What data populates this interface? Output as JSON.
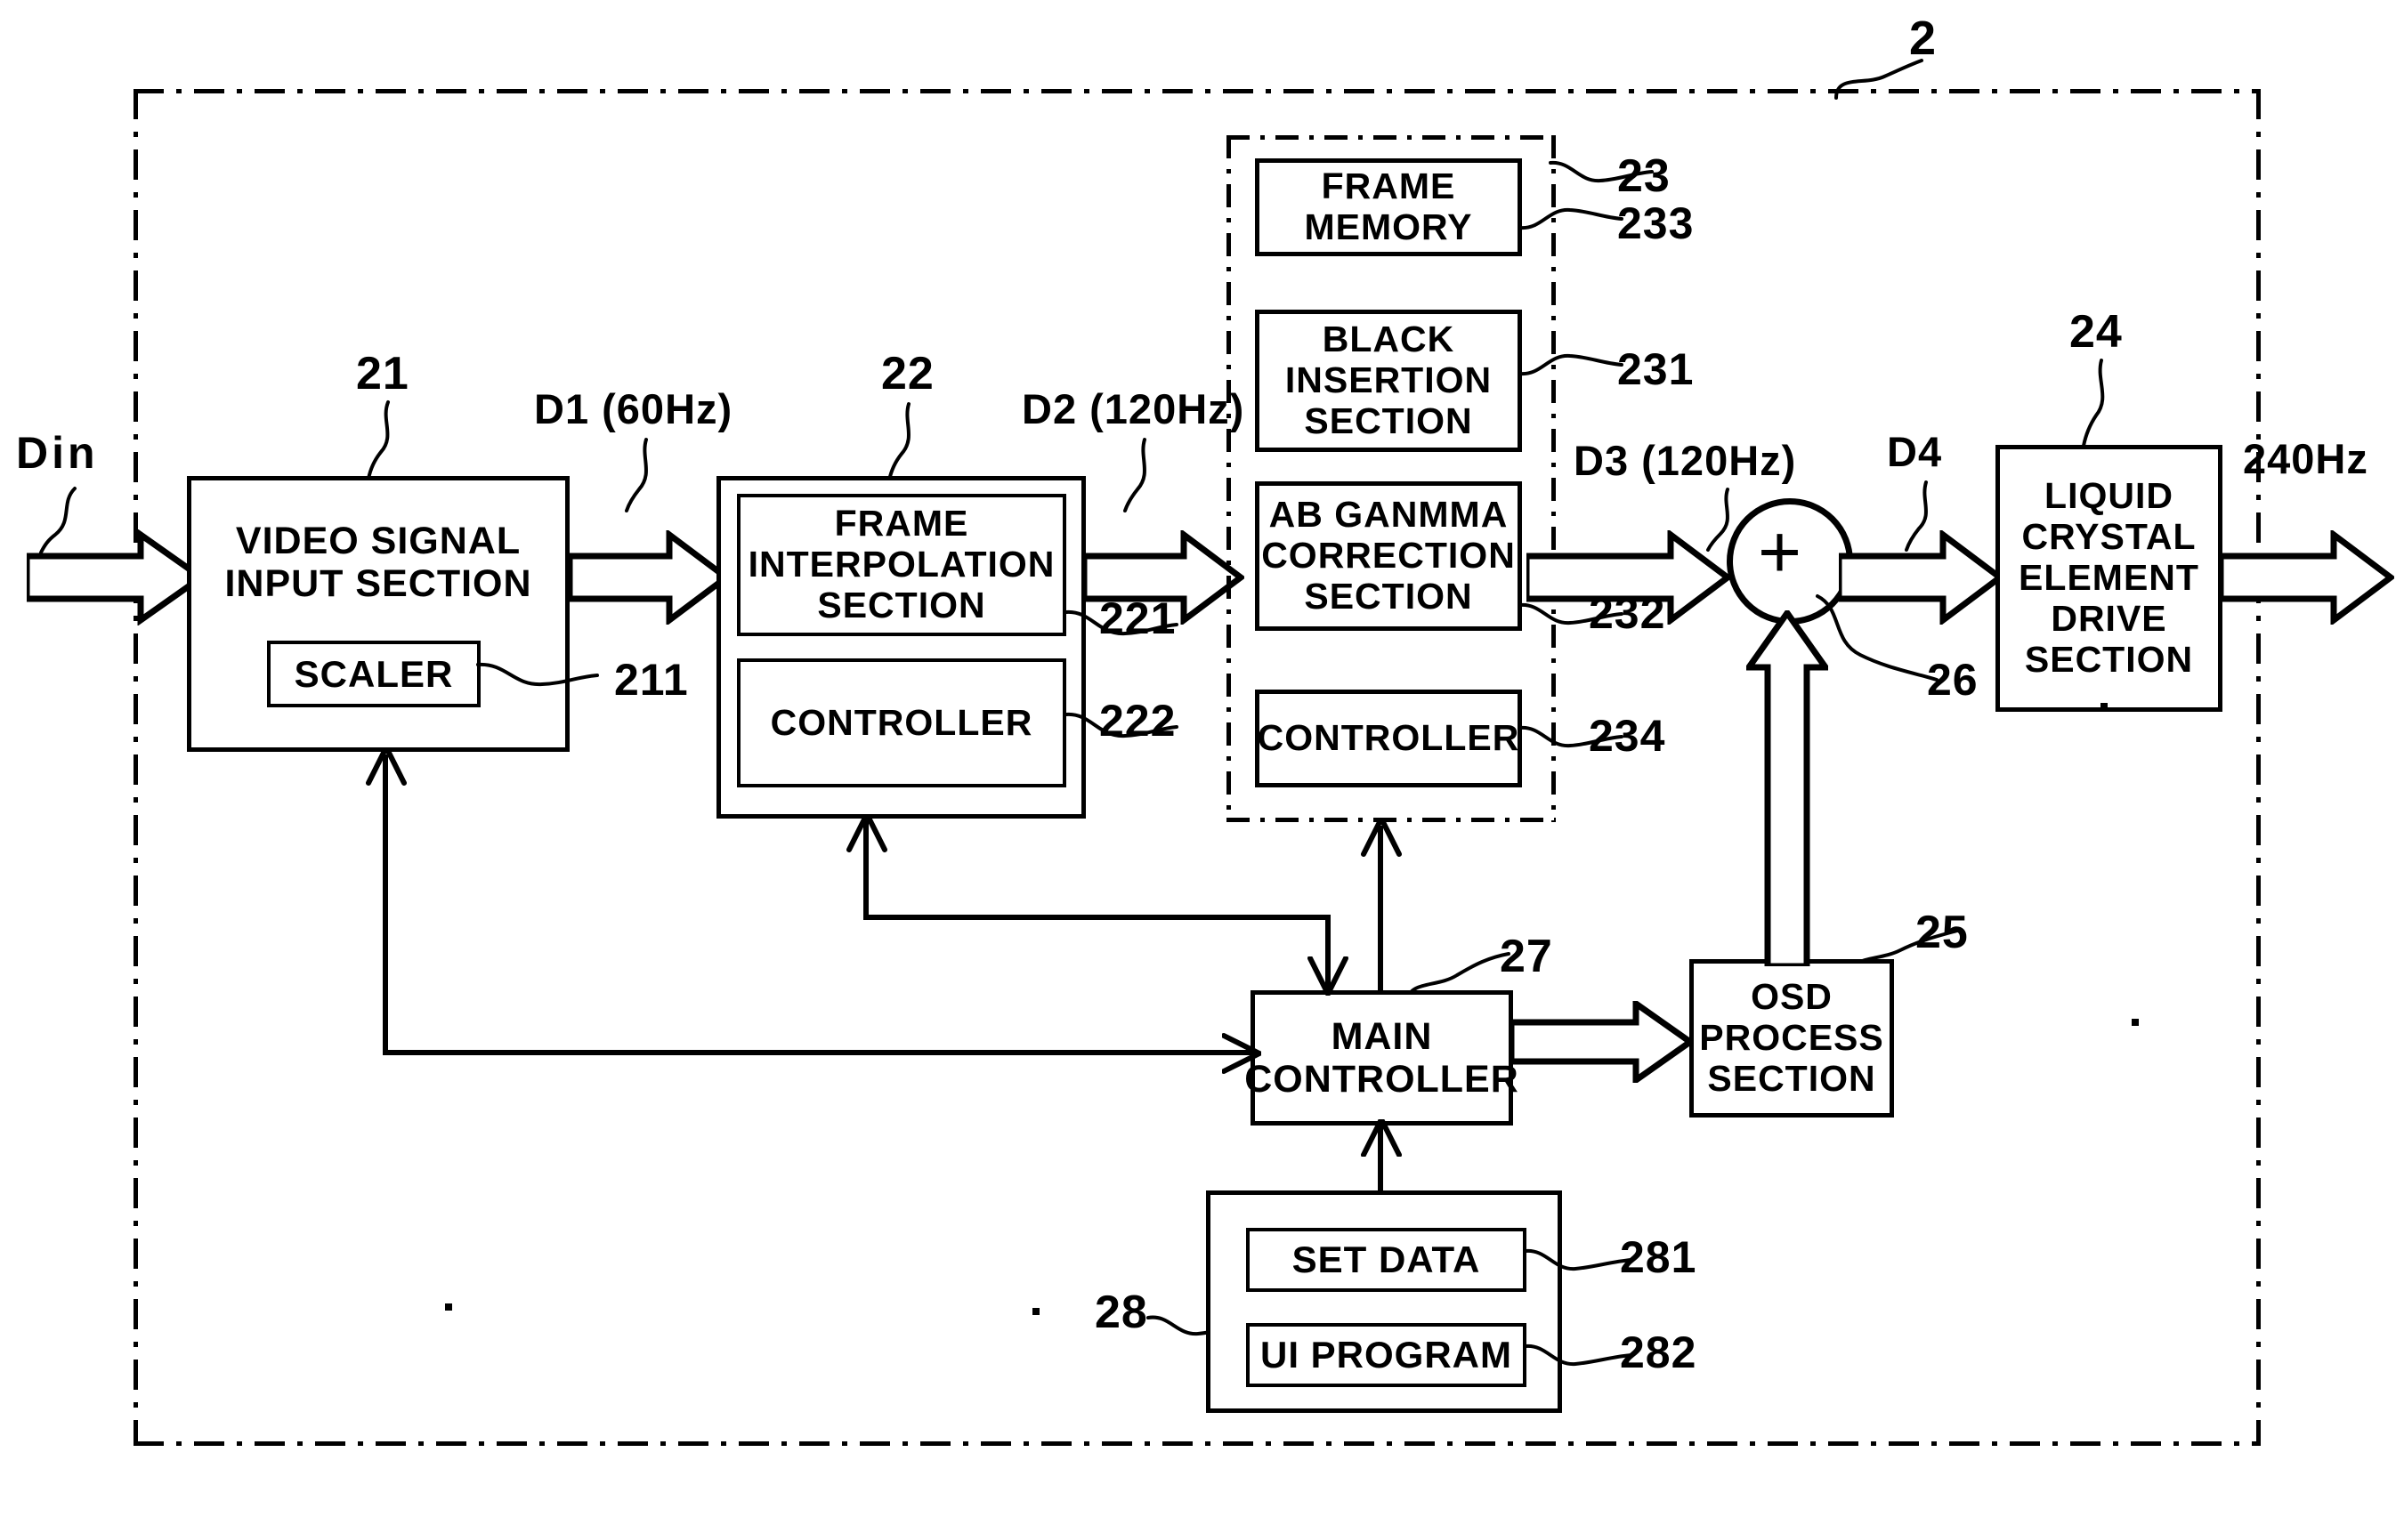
{
  "figure": {
    "outer_ref": "2",
    "inner_group_ref": "23"
  },
  "signals": {
    "din": "Din",
    "d1": "D1 (60Hz)",
    "d2": "D2 (120Hz)",
    "d3": "D3 (120Hz)",
    "d4": "D4",
    "out": "240Hz"
  },
  "blocks": {
    "video_input": {
      "label": "VIDEO SIGNAL\nINPUT SECTION",
      "ref": "21"
    },
    "scaler": {
      "label": "SCALER",
      "ref": "211"
    },
    "frame_interp_group": {
      "ref": "22"
    },
    "frame_interp": {
      "label": "FRAME\nINTERPOLATION\nSECTION",
      "ref": "221"
    },
    "fi_controller": {
      "label": "CONTROLLER",
      "ref": "222"
    },
    "frame_memory": {
      "label": "FRAME\nMEMORY",
      "ref": "233"
    },
    "black_insertion": {
      "label": "BLACK\nINSERTION\nSECTION",
      "ref": "231"
    },
    "ab_gamma": {
      "label": "AB GANMMA\nCORRECTION\nSECTION",
      "ref": "232"
    },
    "bi_controller": {
      "label": "CONTROLLER",
      "ref": "234"
    },
    "lcd_drive": {
      "label": "LIQUID\nCRYSTAL\nELEMENT\nDRIVE\nSECTION",
      "ref": "24"
    },
    "adder": {
      "label": "+",
      "ref": "26"
    },
    "main_controller": {
      "label": "MAIN\nCONTROLLER",
      "ref": "27"
    },
    "osd": {
      "label": "OSD\nPROCESS\nSECTION",
      "ref": "25"
    },
    "memory_group": {
      "ref": "28"
    },
    "set_data": {
      "label": "SET DATA",
      "ref": "281"
    },
    "ui_program": {
      "label": "UI PROGRAM",
      "ref": "282"
    }
  },
  "colors": {
    "ink": "#000000",
    "paper": "#ffffff"
  }
}
